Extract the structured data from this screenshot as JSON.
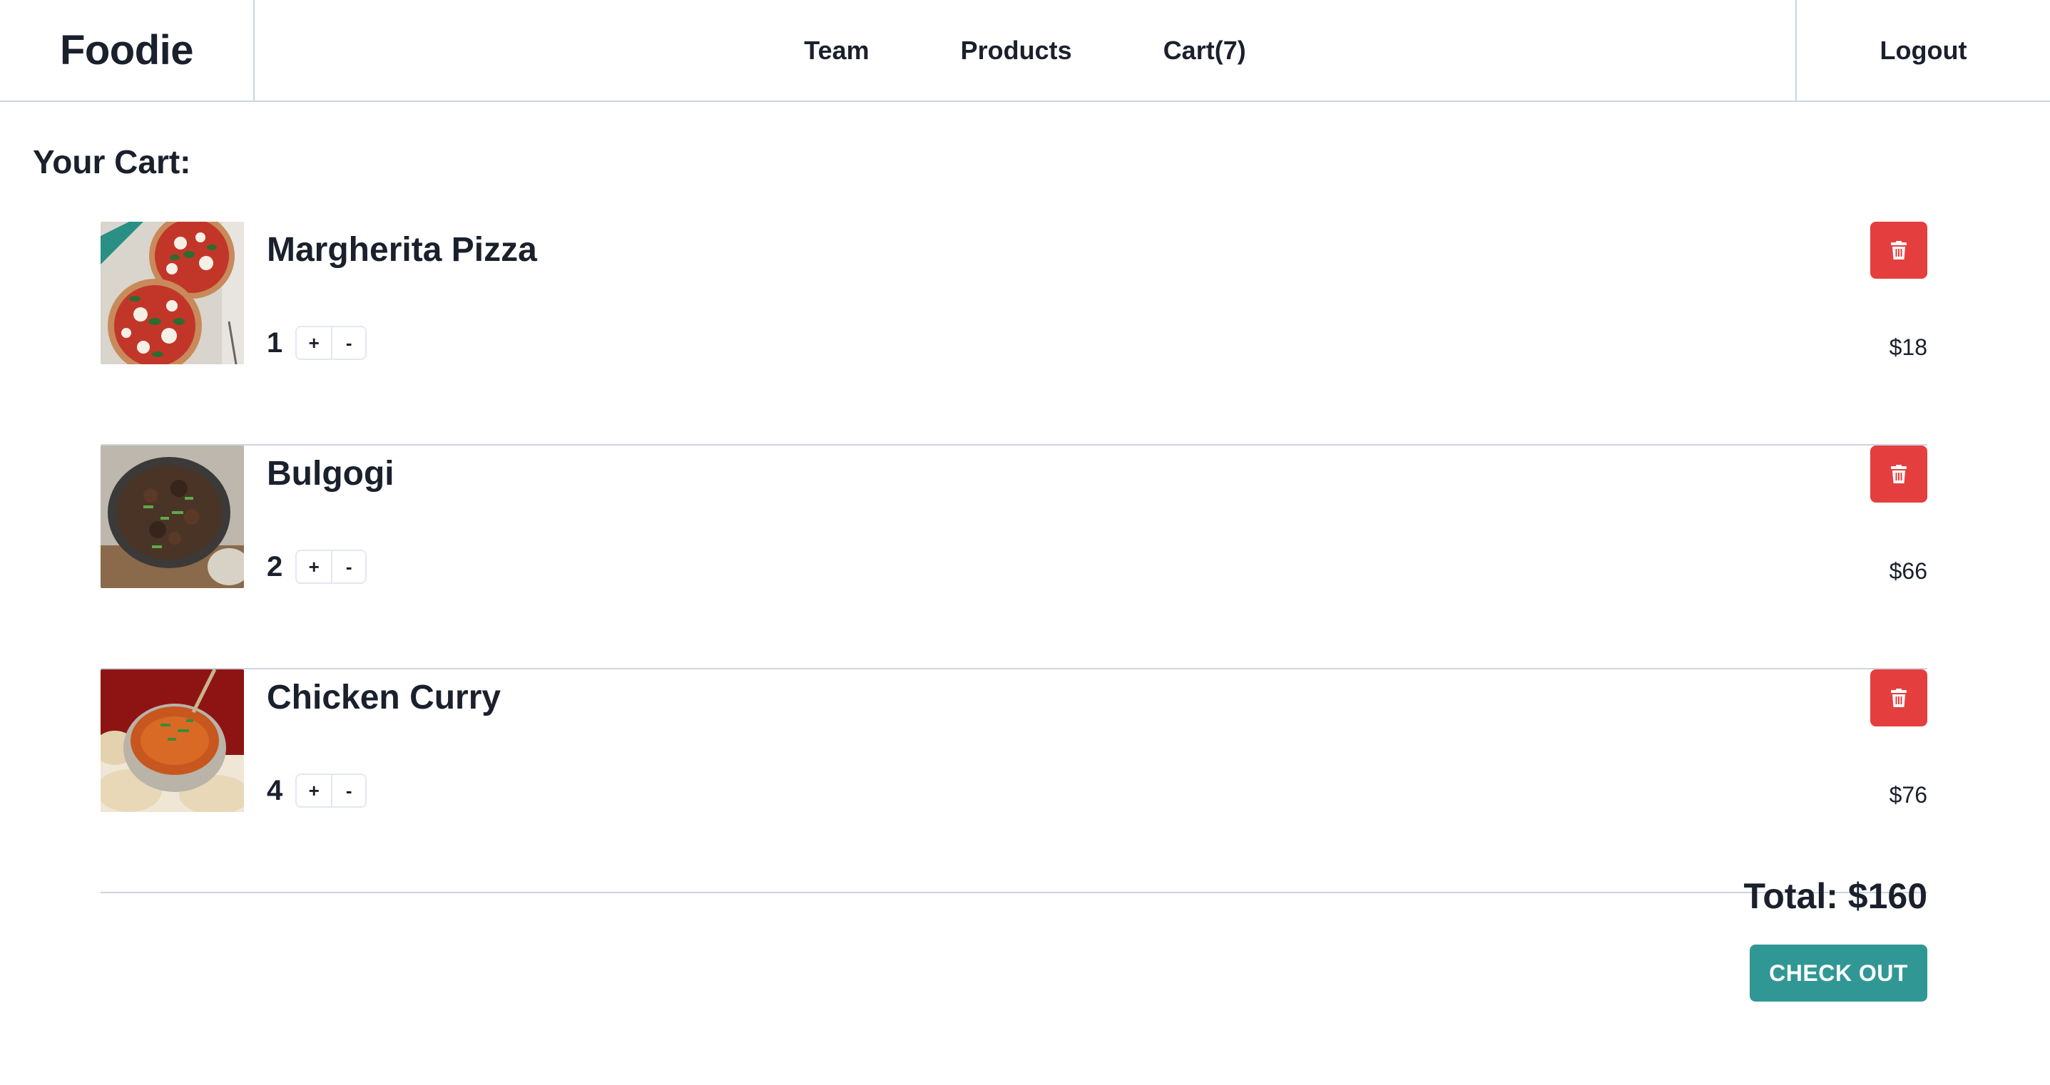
{
  "navbar": {
    "brand": "Foodie",
    "links": [
      {
        "label": "Team"
      },
      {
        "label": "Products"
      },
      {
        "label": "Cart(7)"
      }
    ],
    "logout": "Logout"
  },
  "cart": {
    "title": "Your Cart:",
    "items": [
      {
        "name": "Margherita Pizza",
        "quantity": "1",
        "price": "$18",
        "image": "pizza-photo"
      },
      {
        "name": "Bulgogi",
        "quantity": "2",
        "price": "$66",
        "image": "bulgogi-photo"
      },
      {
        "name": "Chicken Curry",
        "quantity": "4",
        "price": "$76",
        "image": "curry-photo"
      }
    ],
    "plus_label": "+",
    "minus_label": "-",
    "delete_icon": "trash-icon",
    "total": "Total: $160",
    "checkout_label": "CHECK OUT"
  },
  "colors": {
    "accent": "#319795",
    "danger": "#e53e3e",
    "text": "#1a202c",
    "border": "#cbd5e0"
  }
}
